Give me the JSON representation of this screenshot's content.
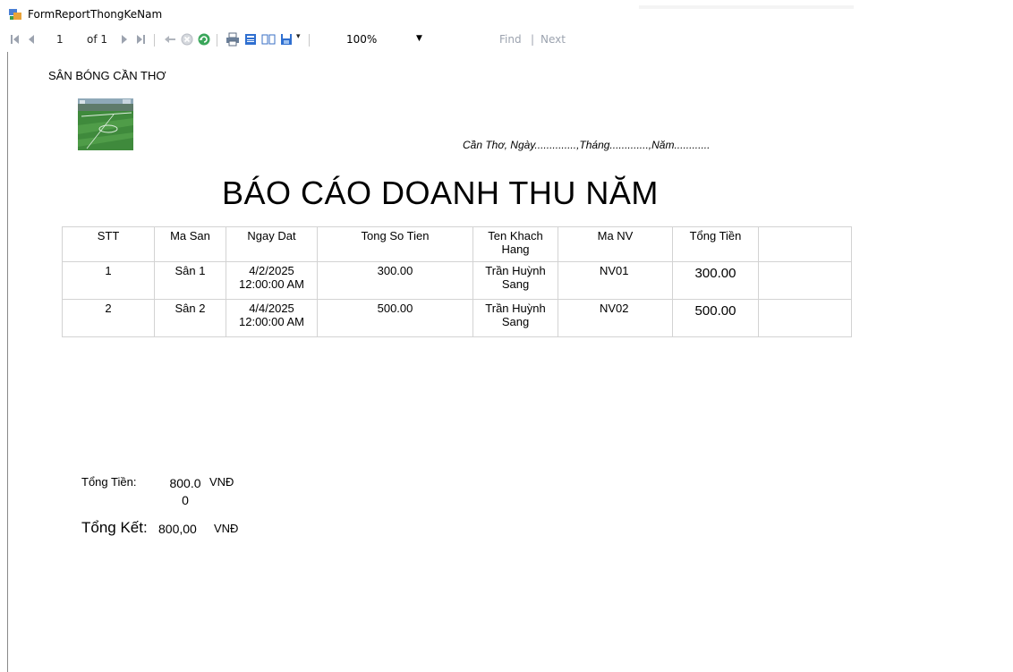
{
  "window": {
    "title": "FormReportThongKeNam"
  },
  "toolbar": {
    "page_current": "1",
    "page_of": "of 1",
    "zoom": "100%",
    "find_label": "Find",
    "separator": "|",
    "next_label": "Next"
  },
  "report": {
    "company": "SÂN BÓNG CẦN THƠ",
    "dateline": "Cần Thơ, Ngày..............,Tháng.............,Năm............",
    "title": "BÁO CÁO DOANH THU NĂM",
    "table": {
      "headers": [
        "STT",
        "Ma San",
        "Ngay Dat",
        "Tong So Tien",
        "Ten Khach Hang",
        "Ma NV",
        "Tổng Tiền",
        ""
      ],
      "rows": [
        [
          "1",
          "Sân 1",
          "4/2/2025 12:00:00 AM",
          "300.00",
          "Trần Huỳnh Sang",
          "NV01",
          "300.00",
          ""
        ],
        [
          "2",
          "Sân 2",
          "4/4/2025 12:00:00 AM",
          "500.00",
          "Trần Huỳnh Sang",
          "NV02",
          "500.00",
          ""
        ]
      ]
    },
    "summary": {
      "sum_label": "Tổng Tiền:",
      "sum_value": "800.00",
      "sum_unit": "VNĐ",
      "total_label": "Tổng Kết:",
      "total_value": "800,00",
      "total_unit": "VNĐ"
    }
  }
}
